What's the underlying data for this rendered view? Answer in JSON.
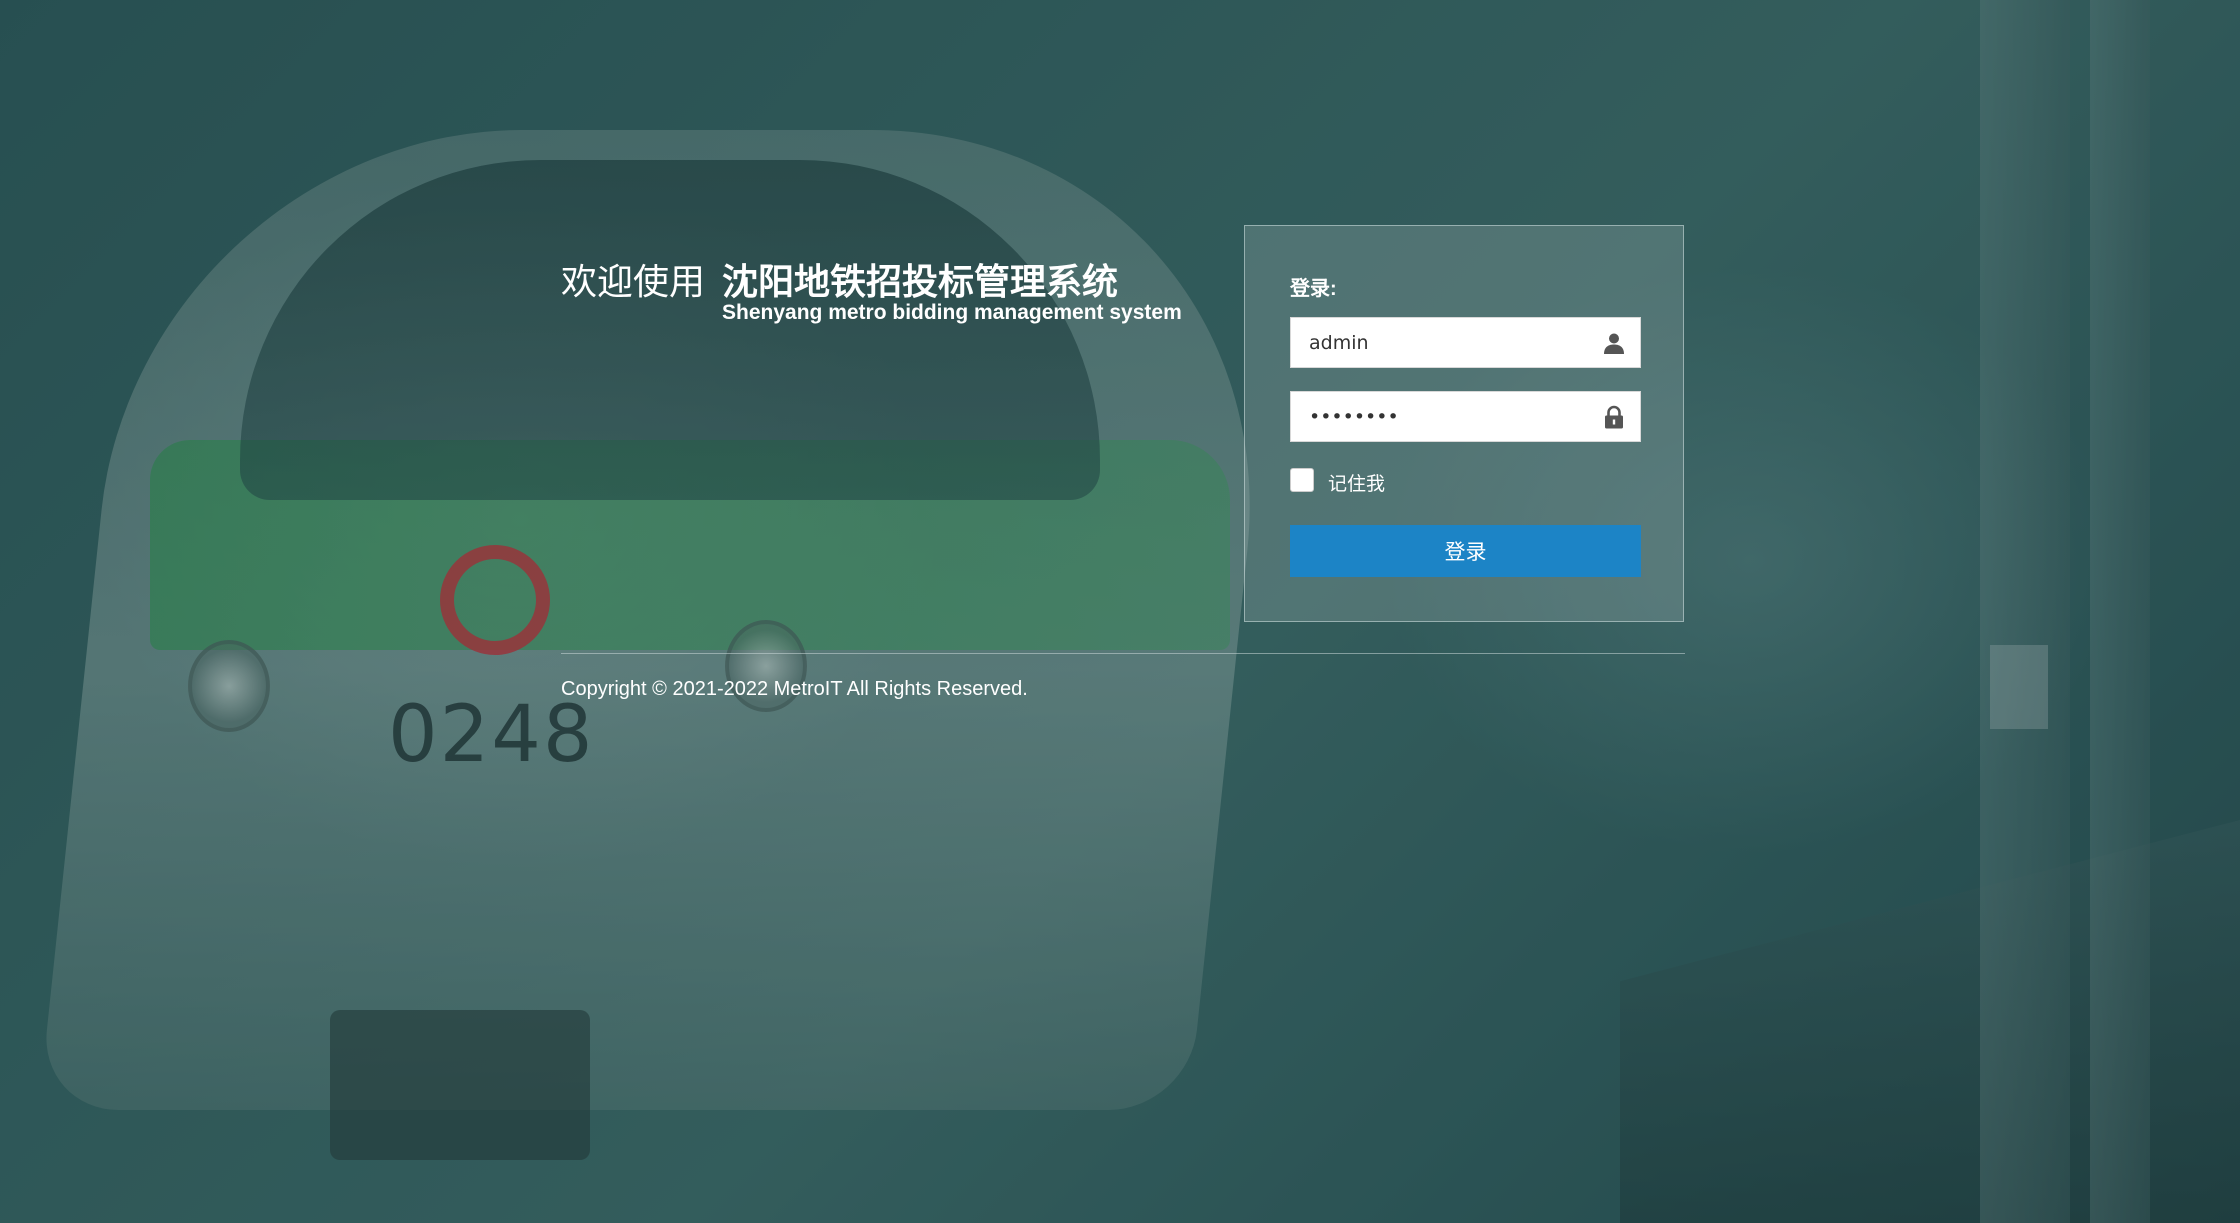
{
  "welcome": {
    "prefix": "欢迎使用",
    "title": "沈阳地铁招投标管理系统",
    "subtitle": "Shenyang metro bidding management system"
  },
  "background": {
    "train_number": "0248"
  },
  "login": {
    "heading": "登录:",
    "username": {
      "value": "admin",
      "icon": "user-icon"
    },
    "password": {
      "value": "password",
      "icon": "lock-icon"
    },
    "remember_label": "记住我",
    "remember_checked": false,
    "submit_label": "登录",
    "accent_color": "#1c84c6"
  },
  "footer": {
    "copyright": "Copyright © 2021-2022 MetroIT All Rights Reserved."
  }
}
